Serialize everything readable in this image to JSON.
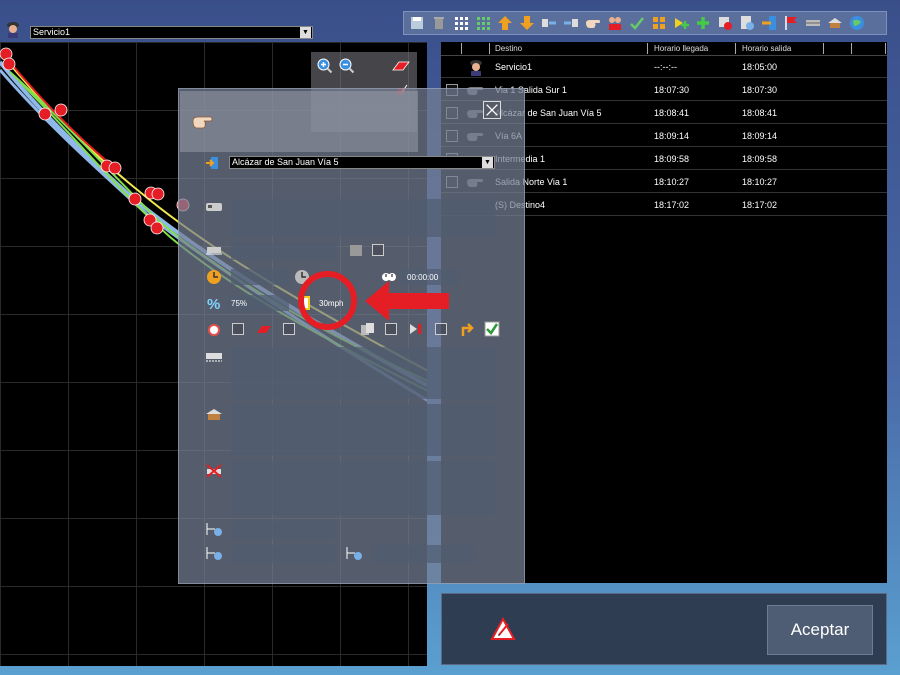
{
  "service": {
    "selected": "Servicio1"
  },
  "toolbar": {
    "icons": [
      "save-icon",
      "trash-icon",
      "grid-icon",
      "grid-green-icon",
      "move-up-icon",
      "move-down-icon",
      "insert-before-icon",
      "insert-after-icon",
      "pointer-hand-icon",
      "drivers-icon",
      "check-edit-icon",
      "grid-orange-icon",
      "add-green-icon",
      "add-yellow-green-icon",
      "delete-red-icon",
      "settings-page-icon",
      "exit-icon",
      "flag-icon",
      "rail-icon",
      "station-icon",
      "globe-icon"
    ]
  },
  "table": {
    "columns": [
      "Destino",
      "Horario llegada",
      "Horario salida"
    ],
    "rows": [
      {
        "dest": "Servicio1",
        "arr": "--:--:--",
        "dep": "18:05:00",
        "icon": "driver-icon"
      },
      {
        "dest": "Via 1 Salida Sur 1",
        "arr": "18:07:30",
        "dep": "18:07:30",
        "icon": "hand-icon"
      },
      {
        "dest": "Alcázar de San Juan Vía 5",
        "arr": "18:08:41",
        "dep": "18:08:41",
        "icon": "hand-icon"
      },
      {
        "dest": "Vía 6A",
        "arr": "18:09:14",
        "dep": "18:09:14",
        "icon": "hand-icon"
      },
      {
        "dest": "Intermedia 1",
        "arr": "18:09:58",
        "dep": "18:09:58",
        "icon": "hand-icon"
      },
      {
        "dest": "Salida Norte Via 1",
        "arr": "18:10:27",
        "dep": "18:10:27",
        "icon": "hand-icon"
      },
      {
        "dest": "(S) Destino4",
        "arr": "18:17:02",
        "dep": "18:17:02",
        "icon": "none"
      }
    ]
  },
  "dialog": {
    "destination": "Alcázar de San Juan Vía 5",
    "time_value": "00:00:00",
    "percent_value": "75%",
    "speed_value": "30mph"
  },
  "footer": {
    "accept_label": "Aceptar"
  },
  "colors": {
    "accent_red": "#e51d24",
    "track_yellow": "#f2e94a",
    "track_blue": "#8fb8e8",
    "track_green": "#7fe04a"
  }
}
